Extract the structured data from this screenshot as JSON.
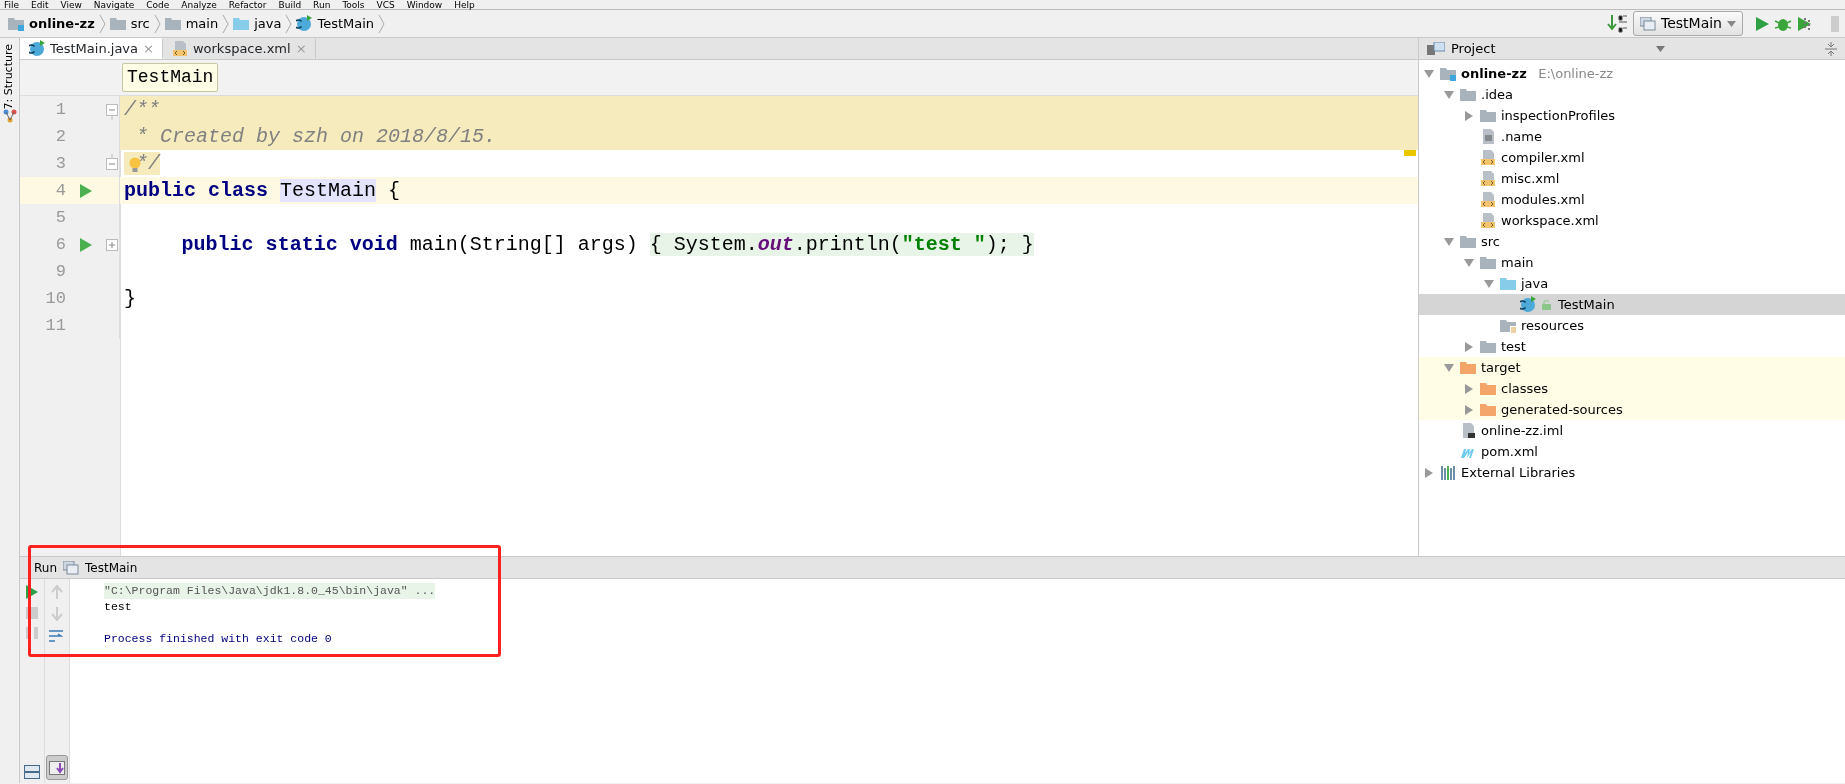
{
  "menu": [
    "File",
    "Edit",
    "View",
    "Navigate",
    "Code",
    "Analyze",
    "Refactor",
    "Build",
    "Run",
    "Tools",
    "VCS",
    "Window",
    "Help"
  ],
  "breadcrumbs": [
    {
      "kind": "module",
      "text": "online-zz"
    },
    {
      "kind": "folder",
      "text": "src"
    },
    {
      "kind": "folder",
      "text": "main"
    },
    {
      "kind": "source",
      "text": "java"
    },
    {
      "kind": "class",
      "text": "TestMain"
    }
  ],
  "toolbar": {
    "run_config": "TestMain"
  },
  "side_strip": {
    "label": "7: Structure"
  },
  "editor_tabs": [
    {
      "kind": "class",
      "label": "TestMain.java",
      "close": "×",
      "selected": true
    },
    {
      "kind": "xml",
      "label": "workspace.xml",
      "close": "×",
      "selected": false
    }
  ],
  "breadcrumb_tooltip": "TestMain",
  "code_lines": [
    {
      "number": "1",
      "kind": "comment",
      "fold_open": true,
      "tokens": [
        {
          "kind": "comment",
          "text": "/**"
        }
      ]
    },
    {
      "number": "2",
      "kind": "comment",
      "tokens": [
        {
          "kind": "comment",
          "text": " * Created by szh on 2018/8/15."
        }
      ]
    },
    {
      "number": "3",
      "kind": "comment-end",
      "fold_close": true,
      "bulb": true,
      "tokens": [
        {
          "kind": "comment",
          "text": " */"
        }
      ]
    },
    {
      "number": "4",
      "kind": "caret",
      "run_marker": true,
      "tokens": [
        {
          "kind": "keyword",
          "text": "public class "
        },
        {
          "kind": "ident-hl",
          "text": "TestMain"
        },
        {
          "kind": "plain",
          "text": " {"
        }
      ]
    },
    {
      "number": "5",
      "kind": "plain"
    },
    {
      "number": "6",
      "kind": "plain",
      "run_marker": true,
      "folded": true,
      "indented": true,
      "tokens": [
        {
          "kind": "keyword",
          "text": "public static void "
        },
        {
          "kind": "plain",
          "text": "main(String[] args) "
        },
        {
          "kind": "folded",
          "text": "{ System."
        },
        {
          "kind": "field",
          "text": "out"
        },
        {
          "kind": "folded",
          "text": ".println("
        },
        {
          "kind": "string",
          "text": "\"test \""
        },
        {
          "kind": "folded",
          "text": "); }"
        }
      ]
    },
    {
      "number": "9",
      "kind": "plain"
    },
    {
      "number": "10",
      "kind": "plain",
      "tokens": [
        {
          "kind": "plain",
          "text": "}"
        }
      ]
    },
    {
      "number": "11",
      "kind": "plain"
    }
  ],
  "project": {
    "title": "Project",
    "tree": [
      {
        "kind": "module",
        "label": "online-zz",
        "path": "E:\\online-zz",
        "expanded": true,
        "selected": false,
        "highlighted": false,
        "children": [
          {
            "kind": "folder",
            "label": ".idea",
            "expanded": true,
            "selected": false,
            "highlighted": false,
            "children": [
              {
                "kind": "folder",
                "label": "inspectionProfiles",
                "expanded": false,
                "selected": false,
                "highlighted": false
              },
              {
                "kind": "text",
                "label": ".name",
                "selected": false,
                "highlighted": false
              },
              {
                "kind": "xml",
                "label": "compiler.xml",
                "selected": false,
                "highlighted": false
              },
              {
                "kind": "xml",
                "label": "misc.xml",
                "selected": false,
                "highlighted": false
              },
              {
                "kind": "xml",
                "label": "modules.xml",
                "selected": false,
                "highlighted": false
              },
              {
                "kind": "xml",
                "label": "workspace.xml",
                "selected": false,
                "highlighted": false
              }
            ]
          },
          {
            "kind": "folder",
            "label": "src",
            "expanded": true,
            "selected": false,
            "highlighted": false,
            "children": [
              {
                "kind": "folder",
                "label": "main",
                "expanded": true,
                "selected": false,
                "highlighted": false,
                "children": [
                  {
                    "kind": "source",
                    "label": "java",
                    "expanded": true,
                    "selected": false,
                    "highlighted": false,
                    "children": [
                      {
                        "kind": "class",
                        "label": "TestMain",
                        "selected": true,
                        "highlighted": false
                      }
                    ]
                  },
                  {
                    "kind": "resources",
                    "label": "resources",
                    "selected": false,
                    "highlighted": false
                  }
                ]
              },
              {
                "kind": "folder",
                "label": "test",
                "expanded": false,
                "selected": false,
                "highlighted": false
              }
            ]
          },
          {
            "kind": "excluded",
            "label": "target",
            "expanded": true,
            "selected": false,
            "highlighted": true,
            "children": [
              {
                "kind": "excluded",
                "label": "classes",
                "expanded": false,
                "selected": false,
                "highlighted": true
              },
              {
                "kind": "excluded",
                "label": "generated-sources",
                "expanded": false,
                "selected": false,
                "highlighted": true
              }
            ]
          },
          {
            "kind": "iml",
            "label": "online-zz.iml",
            "selected": false,
            "highlighted": false
          },
          {
            "kind": "maven",
            "label": "pom.xml",
            "selected": false,
            "highlighted": false
          }
        ]
      },
      {
        "kind": "libraries",
        "label": "External Libraries",
        "expanded": false,
        "selected": false,
        "highlighted": false
      }
    ]
  },
  "run_panel": {
    "label": "Run",
    "tab": "TestMain",
    "console": [
      {
        "kind": "command",
        "text": "\"C:\\Program Files\\Java\\jdk1.8.0_45\\bin\\java\" ..."
      },
      {
        "kind": "output",
        "text": "test"
      },
      {
        "kind": "blank"
      },
      {
        "kind": "system",
        "text": "Process finished with exit code 0"
      }
    ]
  },
  "annotations": [
    {
      "kind": "frame",
      "color": "#ff2020"
    }
  ]
}
